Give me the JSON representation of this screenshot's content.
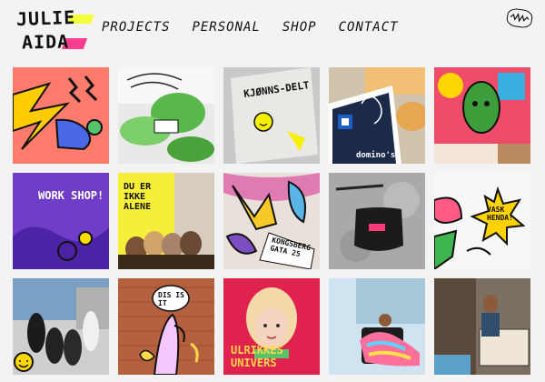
{
  "logo": {
    "line1": "JULIE",
    "line2": "AIDA"
  },
  "nav": [
    "PROJECTS",
    "PERSONAL",
    "SHOP",
    "CONTACT"
  ],
  "badge": "scribble",
  "tiles": [
    {
      "name": "tile-lightning-hand",
      "caption": "",
      "bg": "#ff7b6b",
      "accent": "#ffcc00"
    },
    {
      "name": "tile-plant-sketch",
      "caption": "",
      "bg": "#e8e8e8",
      "accent": "#58b84a"
    },
    {
      "name": "tile-kjonns-poster",
      "caption": "KJØNNS-DELT",
      "bg": "#d7d7d7",
      "accent": "#f6f000"
    },
    {
      "name": "tile-dominos-pizza",
      "caption": "domino's",
      "bg": "#1c2a4a",
      "accent": "#f2c074"
    },
    {
      "name": "tile-mural-face",
      "caption": "",
      "bg": "#ef4c6a",
      "accent": "#3ab0e0"
    },
    {
      "name": "tile-workshop-poster",
      "caption": "WORK SHOP!",
      "bg": "#6f3dc8",
      "accent": "#ffffff"
    },
    {
      "name": "tile-du-er-ikke-alene",
      "caption": "DU ER IKKE ALENE",
      "bg": "#f5ef3a",
      "accent": "#3a2a1a"
    },
    {
      "name": "tile-kongsberg-gata",
      "caption": "KONGSBERG GATA 25",
      "bg": "#e8e1da",
      "accent": "#f7c928"
    },
    {
      "name": "tile-fanny-pack",
      "caption": "",
      "bg": "#a9a9a9",
      "accent": "#111111"
    },
    {
      "name": "tile-vask-hendan",
      "caption": "VASK HENDA!",
      "bg": "#f7f7f7",
      "accent": "#ffd200"
    },
    {
      "name": "tile-group-photo",
      "caption": "",
      "bg": "#7aa0c6",
      "accent": "#ffd800"
    },
    {
      "name": "tile-dis-is-it",
      "caption": "DIS IS IT",
      "bg": "#b5603f",
      "accent": "#f5c6ff"
    },
    {
      "name": "tile-ulrikkes-univers",
      "caption": "ULRIKKES UNIVERS",
      "bg": "#e0234e",
      "accent": "#ffd84a"
    },
    {
      "name": "tile-rainbow-chair",
      "caption": "",
      "bg": "#cfe4f0",
      "accent": "#ff6f9c"
    },
    {
      "name": "tile-sign-carrier",
      "caption": "",
      "bg": "#7b6f63",
      "accent": "#f0e6d8"
    }
  ]
}
